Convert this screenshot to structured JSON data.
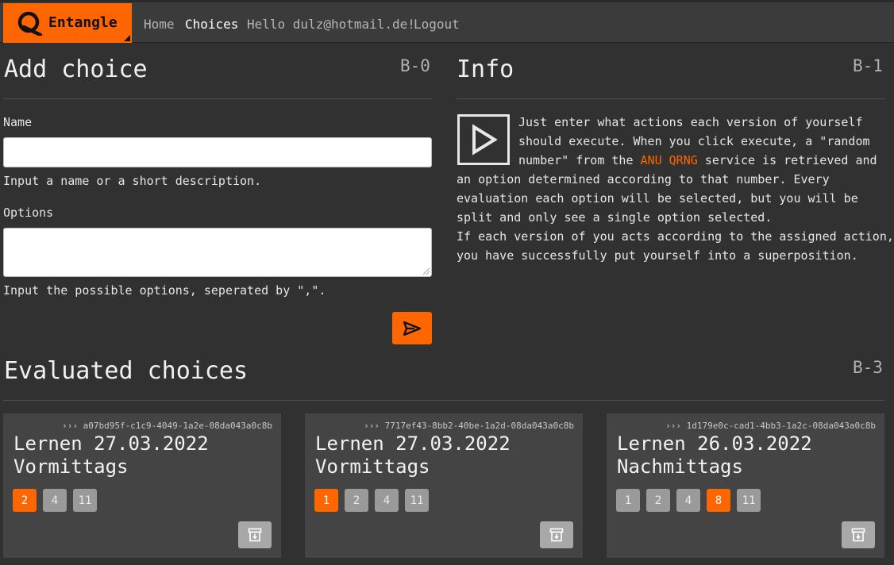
{
  "nav": {
    "brand": "Entangle",
    "home": "Home",
    "choices": "Choices",
    "hello": "Hello dulz@hotmail.de!",
    "logout": "Logout"
  },
  "add_choice": {
    "title": "Add choice",
    "badge": "B-0",
    "name_label": "Name",
    "name_value": "",
    "name_help": "Input a name or a short description.",
    "options_label": "Options",
    "options_value": "",
    "options_help": "Input the possible options, seperated by \",\"."
  },
  "info": {
    "title": "Info",
    "badge": "B-1",
    "line1": "Just enter what actions each version of yourself",
    "line2": "should execute. When you click execute, a \"random",
    "line3_pre": "number\" from the ",
    "line3_link": "ANU QRNG",
    "line3_post": " service is retrieved and",
    "line4": "an option determined according to that number. Every",
    "line5": "evaluation each option will be selected, but you will be",
    "line6": "split and only see a single option selected.",
    "line7": "If each version of you acts according to the assigned action,",
    "line8": "you have successfully put yourself into a superposition."
  },
  "evaluated": {
    "title": "Evaluated choices",
    "badge": "B-3",
    "cards": [
      {
        "id": "››› a07bd95f-c1c9-4049-1a2e-08da043a0c8b",
        "title_line1": "Lernen 27.03.2022",
        "title_line2": "Vormittags",
        "options": [
          "2",
          "4",
          "11"
        ],
        "selected": "2"
      },
      {
        "id": "››› 7717ef43-8bb2-40be-1a2d-08da043a0c8b",
        "title_line1": "Lernen 27.03.2022",
        "title_line2": "Vormittags",
        "options": [
          "1",
          "2",
          "4",
          "11"
        ],
        "selected": "1"
      },
      {
        "id": "››› 1d179e0c-cad1-4bb3-1a2c-08da043a0c8b",
        "title_line1": "Lernen 26.03.2022",
        "title_line2": "Nachmittags",
        "options": [
          "1",
          "2",
          "4",
          "8",
          "11"
        ],
        "selected": "8"
      }
    ]
  },
  "colors": {
    "accent": "#ff6600",
    "background": "#313131",
    "card": "#444444",
    "option_unselected": "#9a9a9a"
  },
  "icons": {
    "brand": "entangle-q-logo-icon",
    "submit": "send-icon",
    "info": "play-icon",
    "archive": "archive-icon"
  }
}
